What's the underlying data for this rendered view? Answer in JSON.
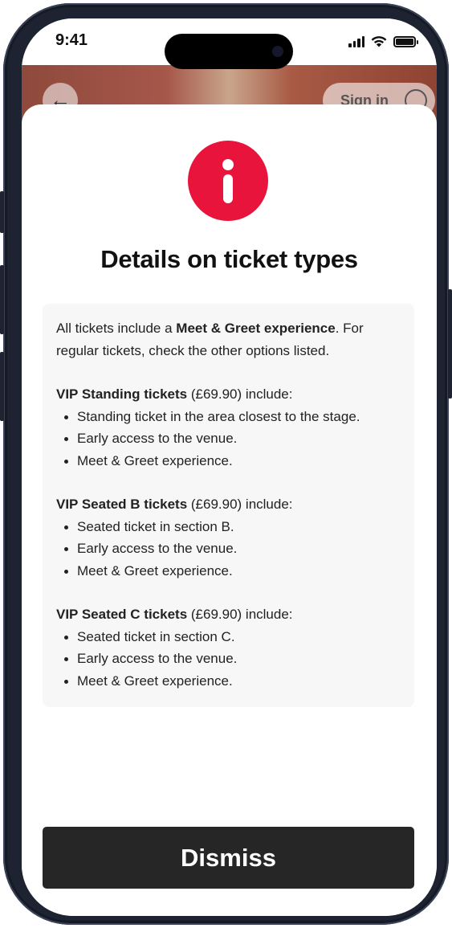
{
  "status_bar": {
    "time": "9:41",
    "icons": [
      "cellular-signal-icon",
      "wifi-icon",
      "battery-icon"
    ]
  },
  "background_app": {
    "back_icon": "arrow-left-icon",
    "sign_in_label": "Sign in",
    "sign_in_icon": "user-icon"
  },
  "sheet": {
    "icon": "info-icon",
    "icon_color": "#e8143c",
    "title": "Details on ticket types",
    "intro": {
      "before": "All tickets include a ",
      "bold": "Meet & Greet experience",
      "after": ". For regular tickets, check the other options listed."
    },
    "ticket_types": [
      {
        "name": "VIP Standing tickets",
        "suffix": " (£69.90) include:",
        "items": [
          "Standing ticket in the area closest to the stage.",
          "Early access to the venue.",
          "Meet & Greet experience."
        ]
      },
      {
        "name": "VIP Seated B tickets",
        "suffix": " (£69.90) include:",
        "items": [
          "Seated ticket in section B.",
          "Early access to the venue.",
          "Meet & Greet experience."
        ]
      },
      {
        "name": "VIP Seated C tickets",
        "suffix": " (£69.90) include:",
        "items": [
          "Seated ticket in section C.",
          "Early access to the venue.",
          "Meet & Greet experience."
        ]
      }
    ],
    "dismiss_label": "Dismiss",
    "dismiss_color": "#262626"
  }
}
